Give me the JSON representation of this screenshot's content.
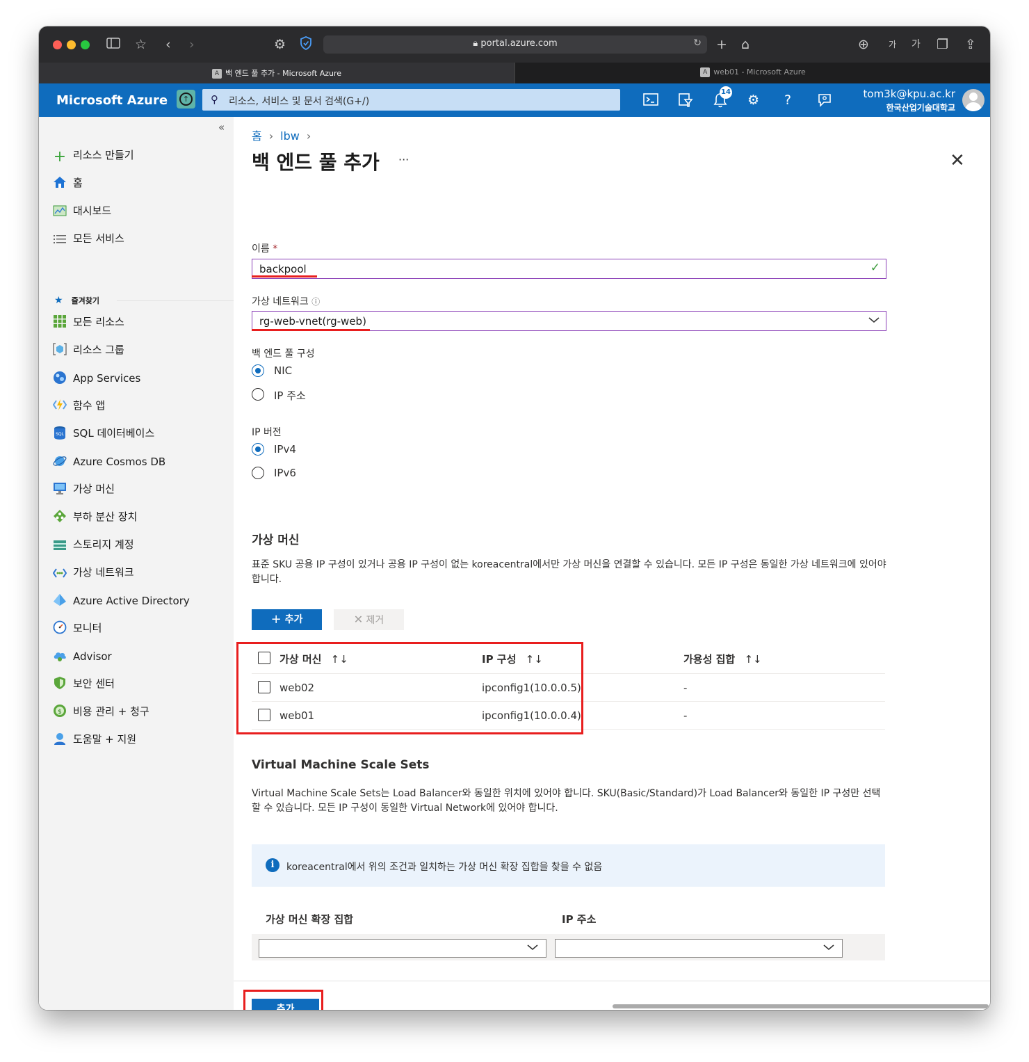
{
  "browser": {
    "url": "portal.azure.com",
    "tabs": [
      {
        "label": "백 엔드 풀 추가 - Microsoft Azure",
        "icon": "A",
        "active": true
      },
      {
        "label": "web01 - Microsoft Azure",
        "icon": "A",
        "active": false
      }
    ],
    "reader_small": "가",
    "reader_large": "가"
  },
  "header": {
    "brand": "Microsoft Azure",
    "search_placeholder": "리소스, 서비스 및 문서 검색(G+/)",
    "notification_count": "14",
    "user_email": "tom3k@kpu.ac.kr",
    "user_org": "한국산업기술대학교",
    "accent_color": "#0f6cbd"
  },
  "sidebar": {
    "collapse_label": "«",
    "items": [
      {
        "label": "리소스 만들기",
        "icon": "plus-icon"
      },
      {
        "label": "홈",
        "icon": "home-icon"
      },
      {
        "label": "대시보드",
        "icon": "dashboard-icon"
      },
      {
        "label": "모든 서비스",
        "icon": "list-icon"
      },
      {
        "label": "즐겨찾기",
        "icon": "star-icon"
      },
      {
        "label": "모든 리소스",
        "icon": "grid-icon"
      },
      {
        "label": "리소스 그룹",
        "icon": "resource-group-icon"
      },
      {
        "label": "App Services",
        "icon": "app-services-icon"
      },
      {
        "label": "함수 앱",
        "icon": "function-icon"
      },
      {
        "label": "SQL 데이터베이스",
        "icon": "sql-icon"
      },
      {
        "label": "Azure Cosmos DB",
        "icon": "cosmos-icon"
      },
      {
        "label": "가상 머신",
        "icon": "vm-icon"
      },
      {
        "label": "부하 분산 장치",
        "icon": "load-balancer-icon"
      },
      {
        "label": "스토리지 계정",
        "icon": "storage-icon"
      },
      {
        "label": "가상 네트워크",
        "icon": "vnet-icon"
      },
      {
        "label": "Azure Active Directory",
        "icon": "aad-icon"
      },
      {
        "label": "모니터",
        "icon": "monitor-icon"
      },
      {
        "label": "Advisor",
        "icon": "advisor-icon"
      },
      {
        "label": "보안 센터",
        "icon": "shield-icon"
      },
      {
        "label": "비용 관리 + 청구",
        "icon": "cost-icon"
      },
      {
        "label": "도움말 + 지원",
        "icon": "help-support-icon"
      }
    ]
  },
  "page": {
    "breadcrumb": [
      "홈",
      "lbw"
    ],
    "title": "백 엔드 풀 추가",
    "more": "···",
    "close": "✕",
    "name_label": "이름",
    "name_required": "*",
    "name_value": "backpool",
    "vnet_label": "가상 네트워크",
    "vnet_value": "rg-web-vnet(rg-web)",
    "pool_config_label": "백 엔드 풀 구성",
    "pool_config_options": [
      {
        "label": "NIC",
        "selected": true
      },
      {
        "label": "IP 주소",
        "selected": false
      }
    ],
    "ip_version_label": "IP 버전",
    "ip_version_options": [
      {
        "label": "IPv4",
        "selected": true
      },
      {
        "label": "IPv6",
        "selected": false
      }
    ],
    "vm_section_title": "가상 머신",
    "vm_section_desc": "표준 SKU 공용 IP 구성이 있거나 공용 IP 구성이 없는 koreacentral에서만 가상 머신을 연결할 수 있습니다. 모든 IP 구성은 동일한 가상 네트워크에 있어야 합니다.",
    "add_button": "추가",
    "remove_button": "제거",
    "vm_table": {
      "columns": [
        "가상 머신",
        "IP 구성",
        "가용성 집합"
      ],
      "rows": [
        {
          "vm": "web02",
          "ip": "ipconfig1(10.0.0.5)",
          "avset": "-"
        },
        {
          "vm": "web01",
          "ip": "ipconfig1(10.0.0.4)",
          "avset": "-"
        }
      ]
    },
    "vmss_section_title": "Virtual Machine Scale Sets",
    "vmss_section_desc": "Virtual Machine Scale Sets는 Load Balancer와 동일한 위치에 있어야 합니다. SKU(Basic/Standard)가 Load Balancer와 동일한 IP 구성만 선택할 수 있습니다. 모든 IP 구성이 동일한 Virtual Network에 있어야 합니다.",
    "vmss_info": "koreacentral에서 위의 조건과 일치하는 가상 머신 확장 집합을 찾을 수 없음",
    "vmss_columns": [
      "가상 머신 확장 집합",
      "IP 주소"
    ],
    "submit_button": "추가"
  }
}
